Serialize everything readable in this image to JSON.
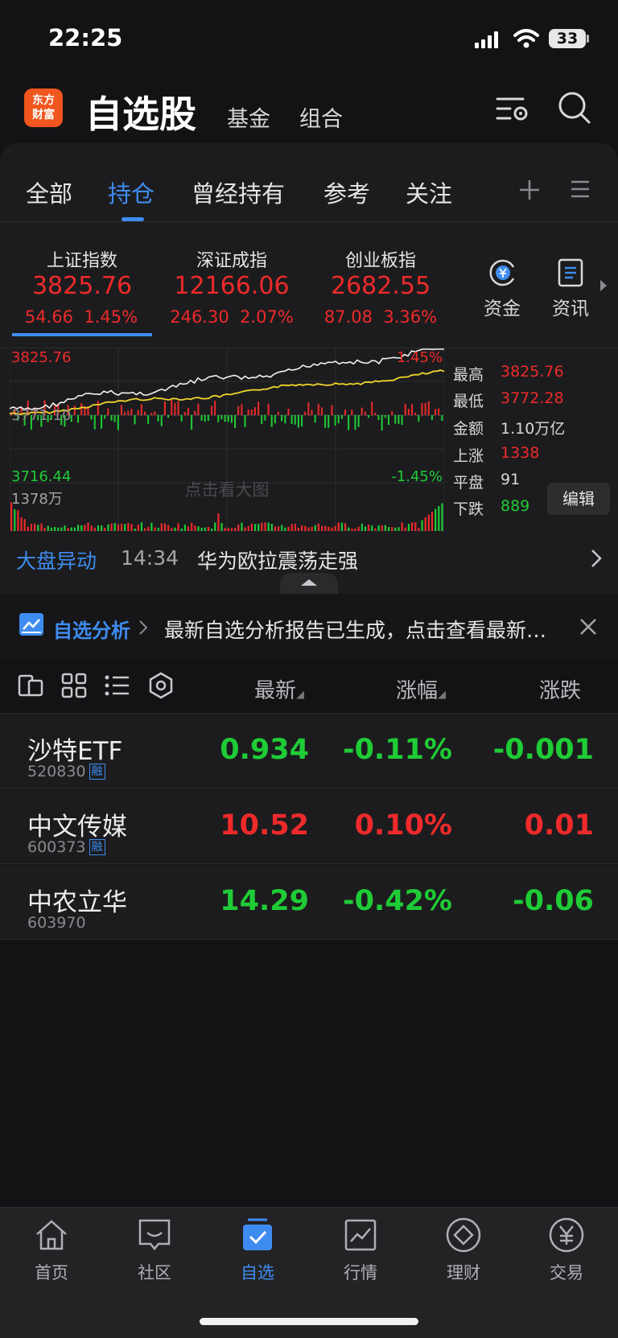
{
  "status": {
    "time": "22:25",
    "battery": "33"
  },
  "header": {
    "logo_line1": "东方",
    "logo_line2": "财富",
    "title": "自选股",
    "tabs": [
      "基金",
      "组合"
    ]
  },
  "sub_tabs": [
    "全部",
    "持仓",
    "曾经持有",
    "参考",
    "关注"
  ],
  "indices": [
    {
      "name": "上证指数",
      "value": "3825.76",
      "change": "54.66",
      "pct": "1.45%"
    },
    {
      "name": "深证成指",
      "value": "12166.06",
      "change": "246.30",
      "pct": "2.07%"
    },
    {
      "name": "创业板指",
      "value": "2682.55",
      "change": "87.08",
      "pct": "3.36%"
    }
  ],
  "quick_actions": [
    {
      "label": "资金",
      "icon": "yuan-circle-icon"
    },
    {
      "label": "资讯",
      "icon": "news-doc-icon"
    }
  ],
  "chart": {
    "high_label": "3825.76",
    "high_pct": "1.45%",
    "low_label": "3716.44",
    "low_pct": "-1.45%",
    "mid_label": "3771.10",
    "volume_label": "1378万",
    "watermark": "点击看大图"
  },
  "stats": [
    {
      "label": "最高",
      "value": "3825.76",
      "color": "#ee2a2a"
    },
    {
      "label": "最低",
      "value": "3772.28",
      "color": "#ee2a2a"
    },
    {
      "label": "金额",
      "value": "1.10万亿",
      "color": "#d8d8d8"
    },
    {
      "label": "上涨",
      "value": "1338",
      "color": "#ee2a2a"
    },
    {
      "label": "平盘",
      "value": "91",
      "color": "#d8d8d8"
    },
    {
      "label": "下跌",
      "value": "889",
      "color": "#1fcc36"
    }
  ],
  "edit_label": "编辑",
  "alert": {
    "tag": "大盘异动",
    "time": "14:34",
    "text": "华为欧拉震荡走强"
  },
  "analysis": {
    "label": "自选分析",
    "text": "最新自选分析报告已生成，点击查看最新分析报告"
  },
  "list_header": {
    "latest": "最新",
    "change_pct": "涨幅",
    "change": "涨跌"
  },
  "stocks": [
    {
      "name": "沙特ETF",
      "code": "520830",
      "tag": "融",
      "price": "0.934",
      "pct": "-0.11%",
      "chg": "-0.001",
      "dir": "down"
    },
    {
      "name": "中文传媒",
      "code": "600373",
      "tag": "融",
      "price": "10.52",
      "pct": "0.10%",
      "chg": "0.01",
      "dir": "up"
    },
    {
      "name": "中农立华",
      "code": "603970",
      "tag": "",
      "price": "14.29",
      "pct": "-0.42%",
      "chg": "-0.06",
      "dir": "down"
    }
  ],
  "nav": [
    {
      "label": "首页",
      "icon": "home-icon"
    },
    {
      "label": "社区",
      "icon": "community-icon"
    },
    {
      "label": "自选",
      "icon": "watchlist-icon"
    },
    {
      "label": "行情",
      "icon": "market-chart-icon"
    },
    {
      "label": "理财",
      "icon": "wealth-diamond-icon"
    },
    {
      "label": "交易",
      "icon": "trade-yuan-icon"
    }
  ],
  "colors": {
    "up": "#ee2a2a",
    "down": "#1fcc36",
    "accent": "#3f8cf0"
  }
}
